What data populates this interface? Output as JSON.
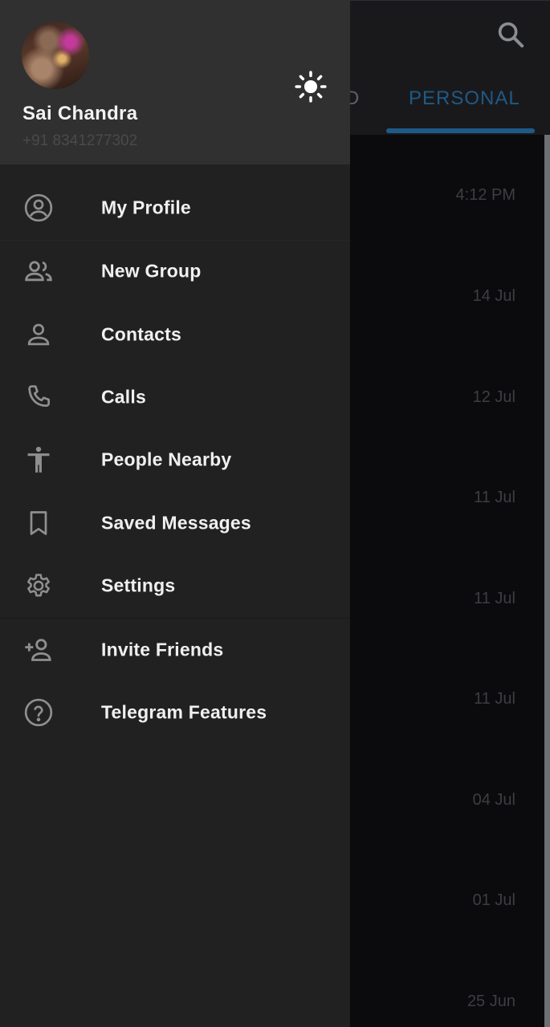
{
  "background": {
    "tabs": [
      "D",
      "PERSONAL"
    ],
    "active_tab": "PERSONAL",
    "chat_times": [
      "4:12 PM",
      "14 Jul",
      "12 Jul",
      "11 Jul",
      "11 Jul",
      "11 Jul",
      "04 Jul",
      "01 Jul",
      "25 Jun"
    ]
  },
  "drawer": {
    "user": {
      "name": "Sai Chandra",
      "phone": "+91 8341277302"
    },
    "menu": [
      {
        "label": "My Profile",
        "icon": "account-circle-icon"
      },
      {
        "label": "New Group",
        "icon": "group-icon"
      },
      {
        "label": "Contacts",
        "icon": "person-icon"
      },
      {
        "label": "Calls",
        "icon": "phone-icon"
      },
      {
        "label": "People Nearby",
        "icon": "accessibility-icon"
      },
      {
        "label": "Saved Messages",
        "icon": "bookmark-icon"
      },
      {
        "label": "Settings",
        "icon": "gear-icon"
      },
      {
        "label": "Invite Friends",
        "icon": "person-add-icon"
      },
      {
        "label": "Telegram Features",
        "icon": "help-circle-icon"
      }
    ]
  },
  "colors": {
    "accent": "#1f5a86",
    "drawer_bg": "#212121",
    "header_bg": "#303030"
  }
}
